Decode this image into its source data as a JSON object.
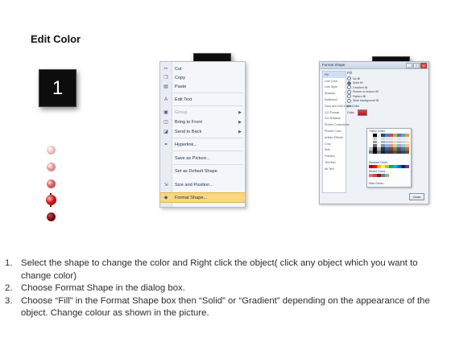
{
  "title": "Edit Color",
  "steps": {
    "one": "1",
    "two": "2",
    "three": "3"
  },
  "context_menu": {
    "items": [
      {
        "label": "Cut",
        "icon": "scissors-icon",
        "glyph": "✂"
      },
      {
        "label": "Copy",
        "icon": "copy-icon",
        "glyph": "❐"
      },
      {
        "label": "Paste",
        "icon": "paste-icon",
        "glyph": "▤"
      },
      {
        "label": "Edit Text",
        "icon": "edit-text-icon",
        "glyph": "A"
      },
      {
        "label": "Group",
        "icon": "group-icon",
        "glyph": "▣"
      },
      {
        "label": "Bring to Front",
        "icon": "bring-front-icon",
        "glyph": "◫"
      },
      {
        "label": "Send to Back",
        "icon": "send-back-icon",
        "glyph": "◪"
      },
      {
        "label": "Hyperlink...",
        "icon": "hyperlink-icon",
        "glyph": "⚭"
      },
      {
        "label": "Save as Picture...",
        "icon": "",
        "glyph": ""
      },
      {
        "label": "Set as Default Shape",
        "icon": "",
        "glyph": ""
      },
      {
        "label": "Size and Position...",
        "icon": "size-icon",
        "glyph": "⇲"
      },
      {
        "label": "Format Shape...",
        "icon": "format-shape-icon",
        "glyph": "◆"
      }
    ],
    "submenu_arrow": "▶"
  },
  "dialog": {
    "title": "Format Shape",
    "minimize": "_",
    "help": "?",
    "close": "x",
    "categories": [
      "Fill",
      "Line Color",
      "Line Style",
      "Shadow",
      "Reflection",
      "Glow and Soft Edges",
      "3-D Format",
      "3-D Rotation",
      "Picture Corrections",
      "Picture Color",
      "Artistic Effects",
      "Crop",
      "Size",
      "Position",
      "Text Box",
      "Alt Text"
    ],
    "panel_heading": "Fill",
    "fill_options": [
      "No fill",
      "Solid fill",
      "Gradient fill",
      "Picture or texture fill",
      "Pattern fill",
      "Slide background fill"
    ],
    "fill_color_label": "Fill Color",
    "color_label": "Color:",
    "theme_colors_label": "Theme Colors",
    "standard_colors_label": "Standard Colors",
    "recent_colors_label": "Recent Colors",
    "more_colors_label": "More Colors...",
    "close_button": "Close"
  },
  "palette": {
    "theme_top": [
      "#ffffff",
      "#000000",
      "#eeece1",
      "#1f497d",
      "#4f81bd",
      "#c0504d",
      "#9bbb59",
      "#8064a2",
      "#4bacc6",
      "#f79646"
    ],
    "standard": [
      "#c00000",
      "#ff0000",
      "#ffc000",
      "#ffff00",
      "#92d050",
      "#00b050",
      "#00b0f0",
      "#0070c0",
      "#002060",
      "#7030a0"
    ],
    "recent": [
      "#e46c6c",
      "#c0504d",
      "#8b1a1a",
      "#4f81bd",
      "#9bbb59"
    ]
  },
  "instructions": [
    {
      "num": "1.",
      "text": "Select the shape to change the color and Right click the object( click any object which you want to change color)"
    },
    {
      "num": "2.",
      "text": "Choose Format Shape in the dialog box."
    },
    {
      "num": "3.",
      "text": "Choose “Fill” in the Format Shape box then “Solid” or “Gradient” depending on the appearance of the object. Change colour as shown in the picture."
    }
  ]
}
